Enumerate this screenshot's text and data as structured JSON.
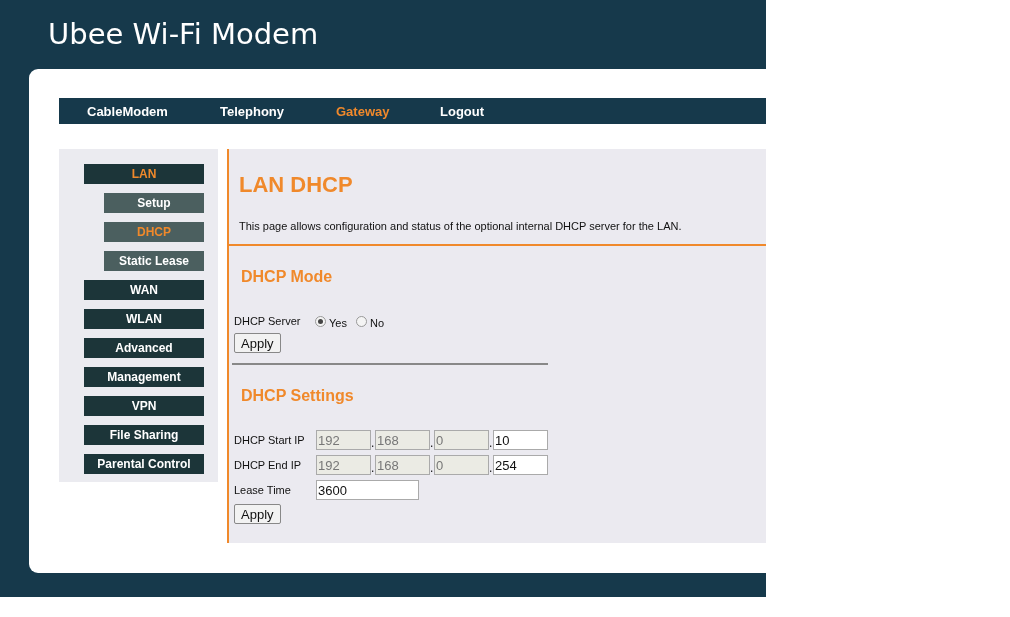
{
  "header": {
    "title": "Ubee Wi-Fi Modem"
  },
  "nav": [
    {
      "label": "CableModem",
      "selected": false
    },
    {
      "label": "Telephony",
      "selected": false
    },
    {
      "label": "Gateway",
      "selected": true
    },
    {
      "label": "Logout",
      "selected": false
    }
  ],
  "sidebar": [
    {
      "label": "LAN",
      "selected": true,
      "children": [
        {
          "label": "Setup",
          "selected": false
        },
        {
          "label": "DHCP",
          "selected": true
        },
        {
          "label": "Static Lease",
          "selected": false
        }
      ]
    },
    {
      "label": "WAN",
      "selected": false
    },
    {
      "label": "WLAN",
      "selected": false
    },
    {
      "label": "Advanced",
      "selected": false
    },
    {
      "label": "Management",
      "selected": false
    },
    {
      "label": "VPN",
      "selected": false
    },
    {
      "label": "File Sharing",
      "selected": false
    },
    {
      "label": "Parental Control",
      "selected": false
    }
  ],
  "page": {
    "title": "LAN DHCP",
    "description": "This page allows configuration and status of the optional internal DHCP server for the LAN."
  },
  "dhcp_mode": {
    "heading": "DHCP Mode",
    "label": "DHCP Server",
    "options": [
      {
        "label": "Yes",
        "selected": true
      },
      {
        "label": "No",
        "selected": false
      }
    ],
    "button": "Apply"
  },
  "dhcp_settings": {
    "heading": "DHCP Settings",
    "rows": [
      {
        "kind": "ip",
        "label": "DHCP Start IP",
        "separator": ".",
        "octets": [
          {
            "value": "192",
            "disabled": true
          },
          {
            "value": "168",
            "disabled": true
          },
          {
            "value": "0",
            "disabled": true
          },
          {
            "value": "10",
            "disabled": false
          }
        ]
      },
      {
        "kind": "ip",
        "label": "DHCP End IP",
        "separator": ".",
        "octets": [
          {
            "value": "192",
            "disabled": true
          },
          {
            "value": "168",
            "disabled": true
          },
          {
            "value": "0",
            "disabled": true
          },
          {
            "value": "254",
            "disabled": false
          }
        ]
      },
      {
        "kind": "text",
        "label": "Lease Time",
        "value": "3600"
      }
    ],
    "button": "Apply"
  }
}
